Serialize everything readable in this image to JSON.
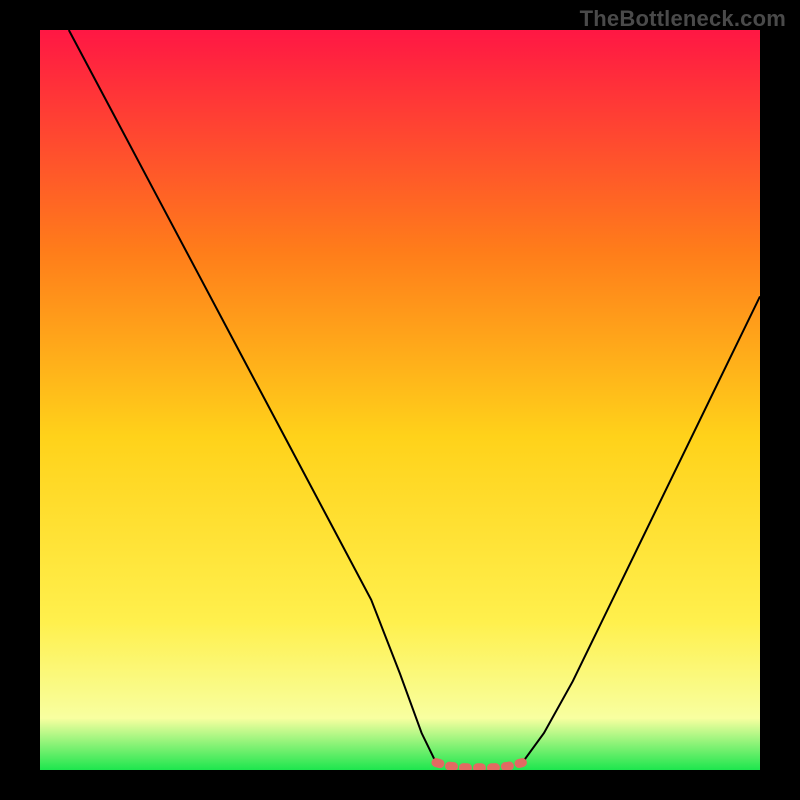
{
  "watermark": "TheBottleneck.com",
  "colors": {
    "frame": "#000000",
    "watermark_text": "#4a4a4a",
    "curve": "#000000",
    "valley_marker": "#e26b62",
    "gradient_top": "#ff1744",
    "gradient_mid1": "#ff7d1a",
    "gradient_mid2": "#ffd21a",
    "gradient_mid3": "#fff04d",
    "gradient_bottom": "#1de64e"
  },
  "chart_data": {
    "type": "line",
    "title": "",
    "xlabel": "",
    "ylabel": "",
    "xlim": [
      0,
      100
    ],
    "ylim": [
      0,
      100
    ],
    "series": [
      {
        "name": "left-branch",
        "x": [
          4,
          10,
          16,
          22,
          28,
          34,
          40,
          46,
          50,
          53,
          55
        ],
        "values": [
          100,
          89,
          78,
          67,
          56,
          45,
          34,
          23,
          13,
          5,
          1
        ]
      },
      {
        "name": "valley-marker",
        "x": [
          55,
          57,
          59,
          61,
          63,
          65,
          67
        ],
        "values": [
          1,
          0.5,
          0.3,
          0.3,
          0.3,
          0.5,
          1
        ]
      },
      {
        "name": "right-branch",
        "x": [
          67,
          70,
          74,
          78,
          82,
          86,
          90,
          94,
          98,
          100
        ],
        "values": [
          1,
          5,
          12,
          20,
          28,
          36,
          44,
          52,
          60,
          64
        ]
      }
    ],
    "gradient_stops": [
      {
        "offset": 0.0,
        "color": "#ff1744"
      },
      {
        "offset": 0.3,
        "color": "#ff7d1a"
      },
      {
        "offset": 0.55,
        "color": "#ffd21a"
      },
      {
        "offset": 0.8,
        "color": "#fff04d"
      },
      {
        "offset": 0.93,
        "color": "#f8ffa0"
      },
      {
        "offset": 1.0,
        "color": "#1de64e"
      }
    ]
  }
}
